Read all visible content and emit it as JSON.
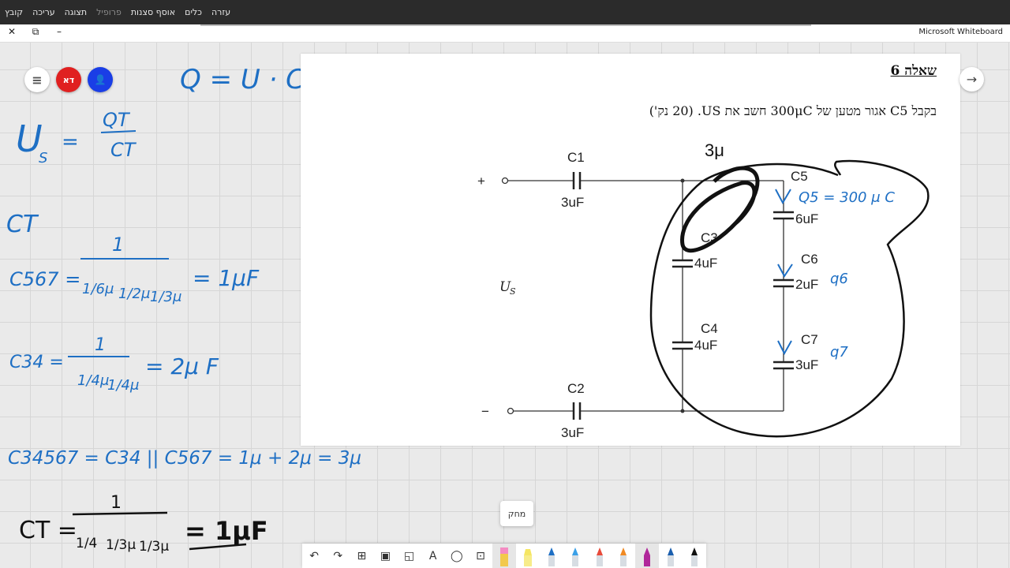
{
  "menu": [
    "קובץ",
    "עריכה",
    "תצוגה",
    "פרופיל",
    "אוסף סצנות",
    "כלים",
    "עזרה"
  ],
  "window": {
    "app_name": "Microsoft Whiteboard",
    "close": "✕",
    "restore": "⧉",
    "minimize": "–"
  },
  "board": {
    "menu_button": "≡",
    "avatar_initials": "דא",
    "person_icon": "👤",
    "next_button": "→"
  },
  "handwriting": {
    "q_formula": "Q = U · C",
    "us_lhs": "U",
    "us_sub": "S",
    "us_eq": "=",
    "us_num": "QT",
    "us_den": "CT",
    "ct_label": "CT",
    "c567_lhs": "C567 =",
    "c567_num": "1",
    "c567_t1": "1/6μ",
    "c567_t2": "1/2μ",
    "c567_t3": "1/3μ",
    "c567_res": "= 1μF",
    "c34_lhs": "C34 =",
    "c34_num": "1",
    "c34_t1": "1/4μ",
    "c34_t2": "1/4μ",
    "c34_res": "= 2μ F",
    "c34567": "C34567 = C34 || C567 = 1μ + 2μ = 3μ",
    "ct_lhs": "CT =",
    "ct_num": "1",
    "ct_t1": "1/4",
    "ct_t2": "1/3μ",
    "ct_t3": "1/3μ",
    "ct_res": "= 1μF",
    "three_mu": "3μ",
    "q5_annot": "Q5 = 300 μ C",
    "q6_annot": "q6",
    "q7_annot": "q7"
  },
  "document": {
    "title": "שאלה 6",
    "question": "בקבל C5 אגור מטען של 300μC חשב את US. (20 נק')"
  },
  "circuit": {
    "plus": "+",
    "minus": "−",
    "source": "U",
    "source_sub": "S",
    "caps": [
      {
        "name": "C1",
        "value": "3uF"
      },
      {
        "name": "C2",
        "value": "3uF"
      },
      {
        "name": "C3",
        "value": "4uF"
      },
      {
        "name": "C4",
        "value": "4uF"
      },
      {
        "name": "C5",
        "value": "6uF"
      },
      {
        "name": "C6",
        "value": "2uF"
      },
      {
        "name": "C7",
        "value": "3uF"
      }
    ]
  },
  "tooltip": "מחק",
  "toolbar": {
    "tools": [
      "undo-icon",
      "redo-icon",
      "add-icon",
      "image-icon",
      "note-icon",
      "text-icon",
      "lasso-icon",
      "ruler-icon",
      "eraser-icon",
      "highlighter-icon",
      "pen-blue-icon",
      "pen-lightblue-icon",
      "pen-red-icon",
      "pen-orange-icon",
      "pen-purple-icon",
      "pen-darkblue-icon",
      "pen-black-icon"
    ],
    "glyphs": {
      "undo": "↶",
      "redo": "↷",
      "add": "⊞",
      "image": "▣",
      "note": "◱",
      "text": "A",
      "lasso": "◯",
      "ruler": "⊡"
    }
  },
  "colors": {
    "ink_blue": "#1e6fc4",
    "ink_black": "#111111",
    "avatar_red": "#e02020",
    "person_blue": "#1a3ee6"
  }
}
